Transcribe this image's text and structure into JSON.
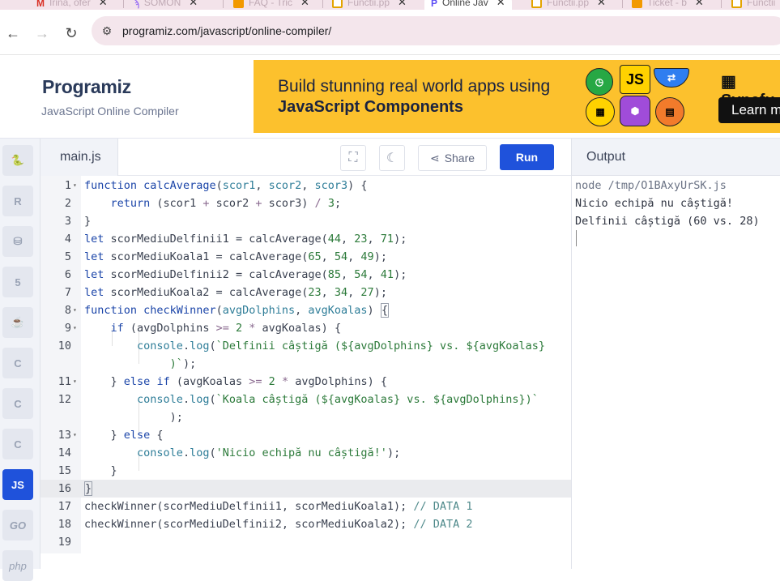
{
  "browser": {
    "tabs": [
      {
        "label": "Irina, ofer",
        "icon": "gmail-icon",
        "active": false
      },
      {
        "label": "SOMON",
        "icon": "somon-icon",
        "active": false
      },
      {
        "label": "FAQ - Tric",
        "icon": "bookmark-icon",
        "active": false
      },
      {
        "label": "Functii.pp",
        "icon": "slides-icon",
        "active": false
      },
      {
        "label": "Online Jav",
        "icon": "programiz-icon",
        "active": true
      },
      {
        "label": "Functii.pp",
        "icon": "slides-icon",
        "active": false
      },
      {
        "label": "Ticket - b",
        "icon": "bookmark-icon",
        "active": false
      },
      {
        "label": "Functii",
        "icon": "slides-icon",
        "active": false
      }
    ],
    "url": "programiz.com/javascript/online-compiler/"
  },
  "header": {
    "logo": "Programiz",
    "subtitle": "JavaScript Online Compiler"
  },
  "ad": {
    "line1": "Build stunning real world apps using",
    "line2": "JavaScript Components",
    "badge": "JS",
    "brand": "Syncfu",
    "cta": "Learn m"
  },
  "sidebar": {
    "items": [
      {
        "label": "",
        "icon": "python-icon",
        "active": false
      },
      {
        "label": "R",
        "icon": "r-icon",
        "active": false
      },
      {
        "label": "",
        "icon": "database-icon",
        "active": false
      },
      {
        "label": "5",
        "icon": "html5-icon",
        "active": false
      },
      {
        "label": "",
        "icon": "java-icon",
        "active": false
      },
      {
        "label": "C",
        "icon": "c-icon",
        "active": false
      },
      {
        "label": "C",
        "icon": "cpp-icon",
        "active": false
      },
      {
        "label": "C",
        "icon": "csharp-icon",
        "active": false
      },
      {
        "label": "JS",
        "icon": "javascript-icon",
        "active": true
      },
      {
        "label": "GO",
        "icon": "go-icon",
        "active": false
      },
      {
        "label": "php",
        "icon": "php-icon",
        "active": false
      }
    ]
  },
  "editor": {
    "filename": "main.js",
    "share_label": "Share",
    "run_label": "Run",
    "lines": [
      "1",
      "2",
      "3",
      "4",
      "5",
      "6",
      "7",
      "8",
      "9",
      "10",
      "",
      "11",
      "12",
      "",
      "13",
      "14",
      "15",
      "16",
      "17",
      "18",
      "19"
    ]
  },
  "output": {
    "title": "Output",
    "lines": [
      "node /tmp/O1BAxyUrSK.js",
      "Nicio echipă nu câștigă!",
      "Delfinii câștigă (60 vs. 28)"
    ]
  }
}
